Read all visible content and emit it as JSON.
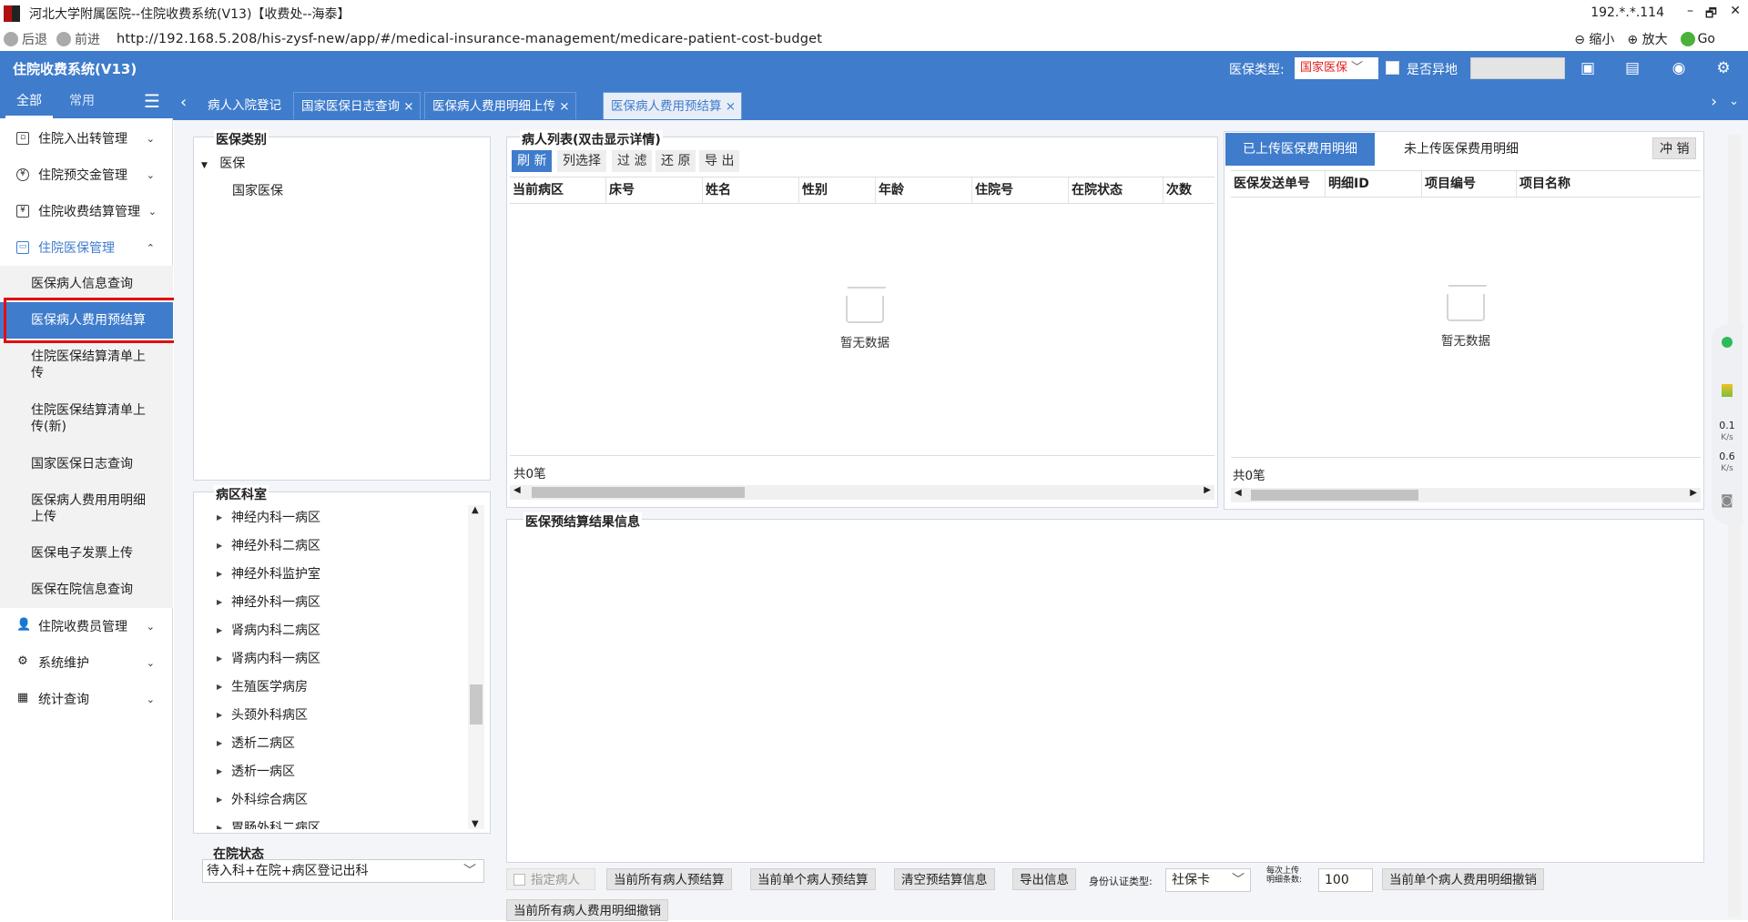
{
  "window": {
    "title": "河北大学附属医院--住院收费系统(V13)【收费处--海泰】",
    "ip": "192.*.*.114",
    "min_btn": "–",
    "restore_btn": "🗗",
    "close_btn": "✕"
  },
  "addressbar": {
    "back": "后退",
    "forward": "前进",
    "url": "http://192.168.5.208/his-zysf-new/app/#/medical-insurance-management/medicare-patient-cost-budget",
    "zoom_out": "缩小",
    "zoom_in": "放大",
    "go": "Go"
  },
  "header": {
    "app_name": "住院收费系统(V13)",
    "insurance_type_label": "医保类型:",
    "insurance_type_value": "国家医保",
    "remote_label": "是否异地",
    "remote_input_value": ""
  },
  "sidebar": {
    "tabs": {
      "all": "全部",
      "common": "常用"
    },
    "items": [
      {
        "label": "住院入出转管理",
        "icon": "calendar-icon"
      },
      {
        "label": "住院预交金管理",
        "icon": "money-icon"
      },
      {
        "label": "住院收费结算管理",
        "icon": "invoice-icon"
      },
      {
        "label": "住院医保管理",
        "icon": "card-icon"
      }
    ],
    "subitems": [
      "医保病人信息查询",
      "医保病人费用预结算",
      "住院医保结算清单上传",
      "住院医保结算清单上传(新)",
      "国家医保日志查询",
      "医保病人费用用明细上传",
      "医保电子发票上传",
      "医保在院信息查询"
    ],
    "items2": [
      {
        "label": "住院收费员管理",
        "icon": "user-icon"
      },
      {
        "label": "系统维护",
        "icon": "gear-icon"
      },
      {
        "label": "统计查询",
        "icon": "chart-icon"
      }
    ]
  },
  "tabs": [
    "病人入院登记",
    "国家医保日志查询",
    "医保病人费用明细上传",
    "医保病人费用预结算"
  ],
  "category_panel": {
    "title": "医保类别",
    "root": "医保",
    "child": "国家医保"
  },
  "dept_panel": {
    "title": "病区科室",
    "items": [
      "神经内科一病区",
      "神经外科二病区",
      "神经外科监护室",
      "神经外科一病区",
      "肾病内科二病区",
      "肾病内科一病区",
      "生殖医学病房",
      "头颈外科病区",
      "透析二病区",
      "透析一病区",
      "外科综合病区",
      "胃肠外科二病区"
    ]
  },
  "status_panel": {
    "title": "在院状态",
    "value": "待入科+在院+病区登记出科"
  },
  "patient_panel": {
    "title": "病人列表(双击显示详情)",
    "buttons": [
      "刷 新",
      "列选择",
      "过 滤",
      "还 原",
      "导 出"
    ],
    "columns": [
      "当前病区",
      "床号",
      "姓名",
      "性别",
      "年龄",
      "住院号",
      "在院状态",
      "次数"
    ],
    "empty": "暂无数据",
    "count": "共0笔"
  },
  "detail_panel": {
    "tabs": [
      "已上传医保费用明细",
      "未上传医保费用明细"
    ],
    "reverse_btn": "冲 销",
    "columns": [
      "医保发送单号",
      "明细ID",
      "项目编号",
      "项目名称"
    ],
    "empty": "暂无数据",
    "count": "共0笔"
  },
  "result_panel": {
    "title": "医保预结算结果信息"
  },
  "bottom": {
    "designated_patient": "指定病人",
    "all_prebudget": "当前所有病人预结算",
    "single_prebudget": "当前单个病人预结算",
    "clear_info": "清空预结算信息",
    "export_info": "导出信息",
    "id_type_label": "身份认证类型:",
    "id_type_value": "社保卡",
    "upload_qty_label_1": "每次上传",
    "upload_qty_label_2": "明细条数:",
    "upload_qty_value": "100",
    "single_revoke": "当前单个病人费用明细撤销",
    "all_revoke": "当前所有病人费用明细撤销"
  },
  "floatbar": {
    "up": "0.1",
    "down": "0.6",
    "unit": "K/s"
  }
}
